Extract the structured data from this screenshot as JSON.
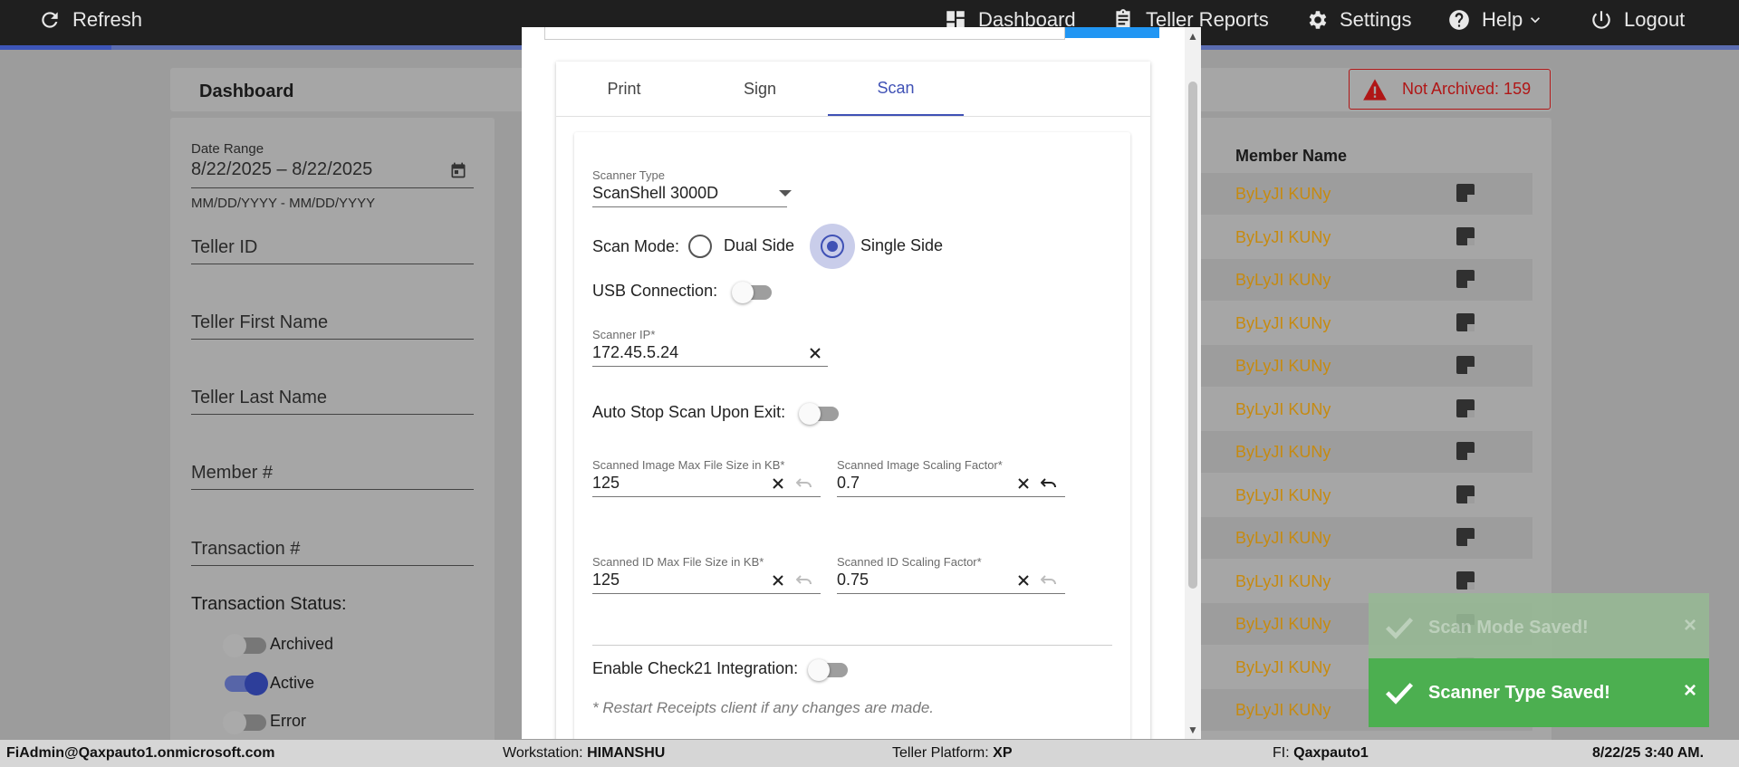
{
  "topbar": {
    "refresh": "Refresh",
    "dashboard": "Dashboard",
    "teller_reports": "Teller Reports",
    "settings": "Settings",
    "help": "Help",
    "logout": "Logout",
    "icons": [
      "refresh-icon",
      "dashboard-icon",
      "clipboard-icon",
      "gear-icon",
      "help-icon",
      "chevron-down-icon",
      "power-icon"
    ]
  },
  "dashboard": {
    "title": "Dashboard",
    "not_archived": "Not Archived: 159",
    "filters": {
      "date_range_label": "Date Range",
      "date_range_value": "8/22/2025 – 8/22/2025",
      "date_range_hint": "MM/DD/YYYY - MM/DD/YYYY",
      "teller_id": "Teller ID",
      "teller_first_name": "Teller First Name",
      "teller_last_name": "Teller Last Name",
      "member_number": "Member #",
      "transaction_number": "Transaction #",
      "transaction_status": "Transaction Status:",
      "statuses": [
        {
          "label": "Archived",
          "on": false
        },
        {
          "label": "Active",
          "on": true
        },
        {
          "label": "Error",
          "on": false
        }
      ]
    },
    "table": {
      "member_name_header": "Member Name",
      "rows": [
        "ByLyJI KUNy",
        "ByLyJI KUNy",
        "ByLyJI KUNy",
        "ByLyJI KUNy",
        "ByLyJI KUNy",
        "ByLyJI KUNy",
        "ByLyJI KUNy",
        "ByLyJI KUNy",
        "ByLyJI KUNy",
        "ByLyJI KUNy",
        "ByLyJI KUNy",
        "ByLyJI KUNy",
        "ByLyJI KUNy"
      ]
    }
  },
  "modal": {
    "tabs": [
      "Print",
      "Sign",
      "Scan"
    ],
    "active_tab": "Scan",
    "scan": {
      "scanner_type_label": "Scanner Type",
      "scanner_type_value": "ScanShell 3000D",
      "scan_mode_label": "Scan Mode:",
      "dual_side": "Dual Side",
      "single_side": "Single Side",
      "selected_mode": "Single Side",
      "usb_connection": "USB Connection:",
      "usb_on": false,
      "scanner_ip_label": "Scanner IP*",
      "scanner_ip_value": "172.45.5.24",
      "auto_stop": "Auto Stop Scan Upon Exit:",
      "auto_stop_on": false,
      "image_max_label": "Scanned Image Max File Size in KB*",
      "image_max_value": "125",
      "image_scaling_label": "Scanned Image Scaling Factor*",
      "image_scaling_value": "0.7",
      "id_max_label": "Scanned ID Max File Size in KB*",
      "id_max_value": "125",
      "id_scaling_label": "Scanned ID Scaling Factor*",
      "id_scaling_value": "0.75",
      "check21": "Enable Check21 Integration:",
      "check21_on": false,
      "note": "* Restart Receipts client if any changes are made."
    }
  },
  "toasts": [
    {
      "text": "Scan Mode Saved!",
      "faded": true
    },
    {
      "text": "Scanner Type Saved!",
      "faded": false
    }
  ],
  "statusbar": {
    "user": "FiAdmin@Qaxpauto1.onmicrosoft.com",
    "workstation_label": "Workstation:",
    "workstation_value": "HIMANSHU",
    "platform_label": "Teller Platform:",
    "platform_value": "XP",
    "fi_label": "FI:",
    "fi_value": "Qaxpauto1",
    "datetime": "8/22/25 3:40 AM."
  },
  "colors": {
    "accent": "#3f51b5",
    "toast_green": "#4caf50",
    "alert_red": "#b01616",
    "member_name": "#c68a10"
  }
}
